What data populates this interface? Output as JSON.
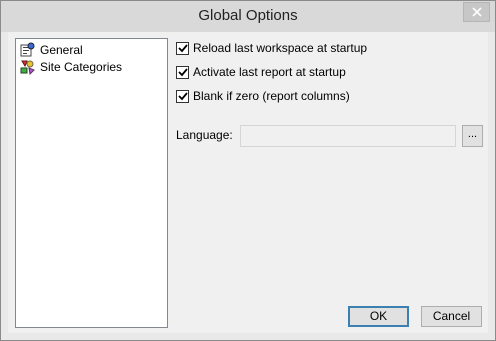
{
  "window": {
    "title": "Global Options"
  },
  "tree": {
    "items": [
      {
        "label": "General",
        "icon": "general-settings-icon"
      },
      {
        "label": "Site Categories",
        "icon": "site-categories-icon"
      }
    ]
  },
  "options": {
    "reload_workspace": {
      "label": "Reload last workspace at startup",
      "checked": true
    },
    "activate_report": {
      "label": "Activate last report at startup",
      "checked": true
    },
    "blank_if_zero": {
      "label": "Blank if zero (report columns)",
      "checked": true
    }
  },
  "language": {
    "label": "Language:",
    "value": "",
    "browse_label": "..."
  },
  "buttons": {
    "ok": "OK",
    "cancel": "Cancel"
  },
  "colors": {
    "titlebar": "#d9d9d9",
    "dialog_bg": "#f0f0f0",
    "default_button_border": "#3c7fb1"
  }
}
